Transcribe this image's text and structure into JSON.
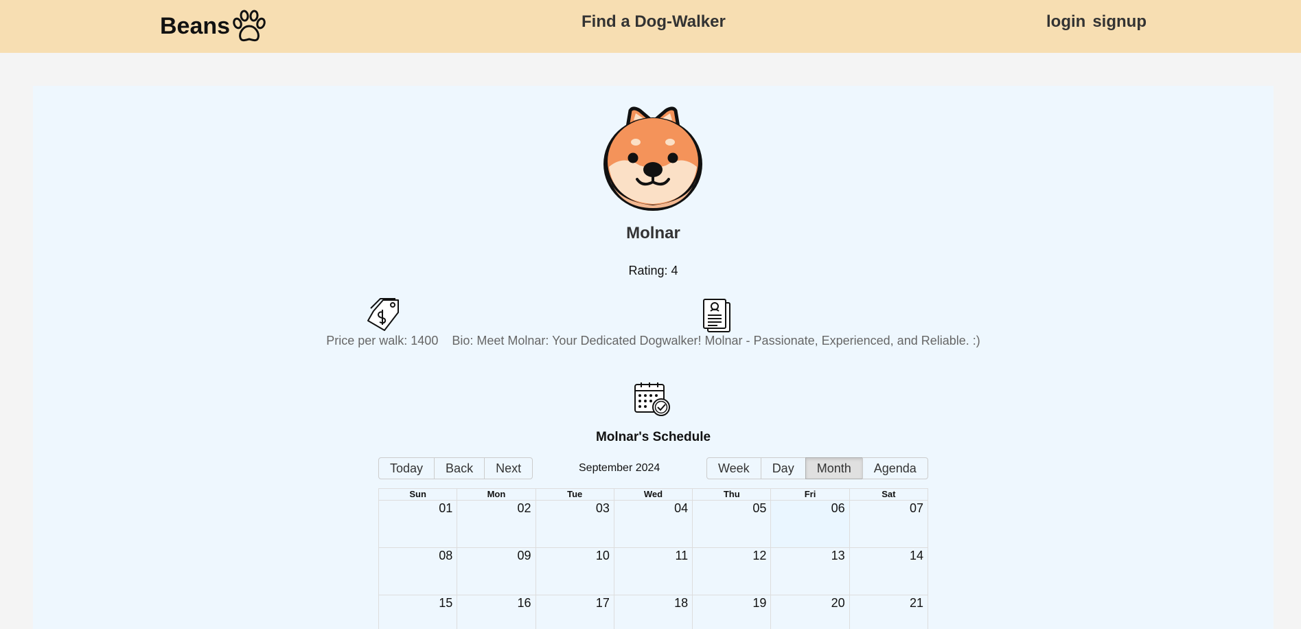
{
  "header": {
    "logo_text": "Beans",
    "logo_icon": "paw-icon",
    "nav_find": "Find a Dog-Walker",
    "nav_login": "login",
    "nav_signup": "signup"
  },
  "profile": {
    "avatar_icon": "shiba-dog-avatar-icon",
    "name": "Molnar",
    "rating": "Rating: 4",
    "price_icon": "price-tag-icon",
    "bio_icon": "document-profile-icon",
    "price": "Price per walk: 1400",
    "bio": "Bio: Meet Molnar: Your Dedicated Dogwalker! Molnar - Passionate, Experienced, and Reliable. :)"
  },
  "schedule": {
    "icon": "calendar-clock-icon",
    "title": "Molnar's Schedule",
    "toolbar": {
      "today": "Today",
      "back": "Back",
      "next": "Next",
      "label": "September 2024",
      "views": [
        "Week",
        "Day",
        "Month",
        "Agenda"
      ],
      "active_view": "Month"
    },
    "weekdays": [
      "Sun",
      "Mon",
      "Tue",
      "Wed",
      "Thu",
      "Fri",
      "Sat"
    ],
    "weeks": [
      [
        "01",
        "02",
        "03",
        "04",
        "05",
        "06",
        "07"
      ],
      [
        "08",
        "09",
        "10",
        "11",
        "12",
        "13",
        "14"
      ],
      [
        "15",
        "16",
        "17",
        "18",
        "19",
        "20",
        "21"
      ]
    ],
    "highlighted_day": "06"
  },
  "colors": {
    "header_bg": "#f7deb2",
    "panel_bg": "#eef7fe",
    "page_bg": "#f4f4f4",
    "active_button_bg": "#e0e0e0"
  }
}
